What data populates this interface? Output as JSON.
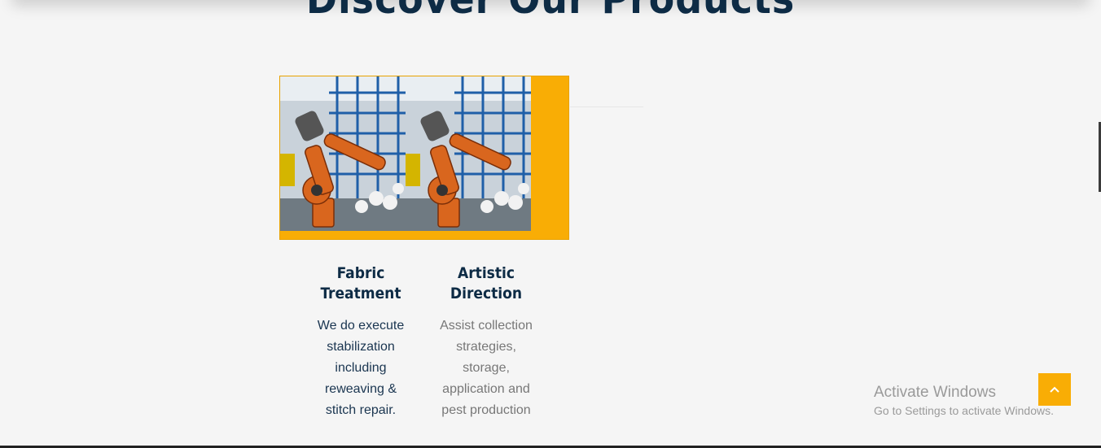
{
  "section": {
    "title": "Discover Our Products"
  },
  "cards": [
    {
      "title": "Fabric Treatment",
      "text": "We do execute stabilization including reweaving & stitch repair.",
      "image_icon": "industrial-robot-image"
    },
    {
      "title": "Artistic Direction",
      "text": "Assist collection strategies, storage, application and pest production",
      "image_icon": "industrial-robot-image"
    }
  ],
  "overlay": {
    "activate_title": "Activate Windows",
    "activate_sub": "Go to Settings to activate Windows."
  },
  "scroll_top": {
    "icon": "chevron-up-icon"
  },
  "colors": {
    "accent": "#f9ad05",
    "heading": "#0d2b45",
    "background": "#f5f5f5"
  }
}
